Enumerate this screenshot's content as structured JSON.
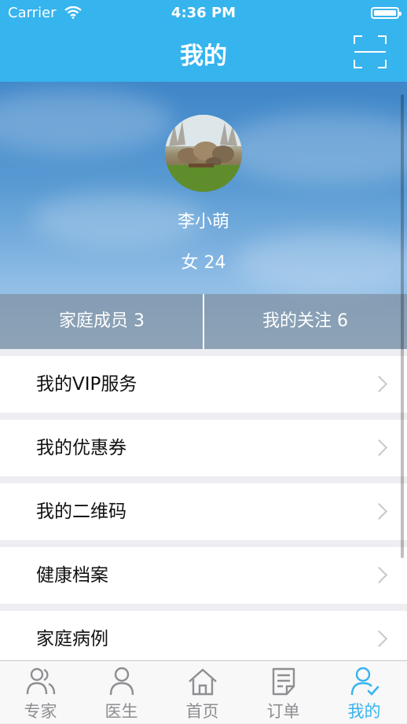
{
  "status_bar": {
    "carrier": "Carrier",
    "time": "4:36 PM"
  },
  "nav": {
    "title": "我的"
  },
  "profile": {
    "name": "李小萌",
    "info": "女  24"
  },
  "stats": {
    "family": "家庭成员 3",
    "following": "我的关注 6"
  },
  "menu": [
    {
      "label": "我的VIP服务"
    },
    {
      "label": "我的优惠券"
    },
    {
      "label": "我的二维码"
    },
    {
      "label": "健康档案"
    },
    {
      "label": "家庭病例"
    }
  ],
  "tabs": [
    {
      "label": "专家",
      "icon": "experts-icon"
    },
    {
      "label": "医生",
      "icon": "doctor-icon"
    },
    {
      "label": "首页",
      "icon": "home-icon"
    },
    {
      "label": "订单",
      "icon": "order-icon"
    },
    {
      "label": "我的",
      "icon": "profile-icon"
    }
  ],
  "colors": {
    "accent": "#36b4ee",
    "tab_inactive": "#8e8e93"
  }
}
